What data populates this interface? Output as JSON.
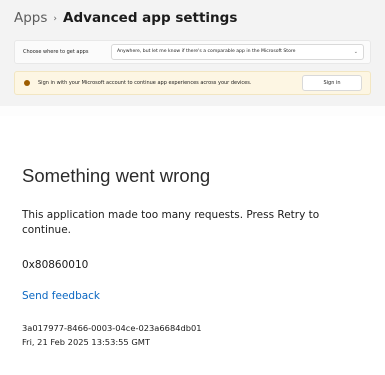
{
  "breadcrumb": {
    "parent": "Apps",
    "separator": "›",
    "current": "Advanced app settings"
  },
  "settings": {
    "source_label": "Choose where to get apps",
    "source_value": "Anywhere, but let me know if there's a comparable app in the Microsoft Store",
    "signin_message": "Sign in with your Microsoft account to continue app experiences across your devices.",
    "signin_button": "Sign in"
  },
  "error": {
    "title": "Something went wrong",
    "message": "This application made too many requests. Press Retry to continue.",
    "code": "0x80860010",
    "feedback_link": "Send feedback",
    "correlation_id": "3a017977-8466-0003-04ce-023a6684db01",
    "timestamp": "Fri, 21 Feb 2025 13:53:55 GMT"
  },
  "icons": {
    "warning": "warning-dot-icon",
    "dropdown": "chevron-down-icon"
  },
  "colors": {
    "link": "#0a67c2",
    "warning_banner": "#fdf6e3",
    "warning_dot": "#9d5d00"
  }
}
